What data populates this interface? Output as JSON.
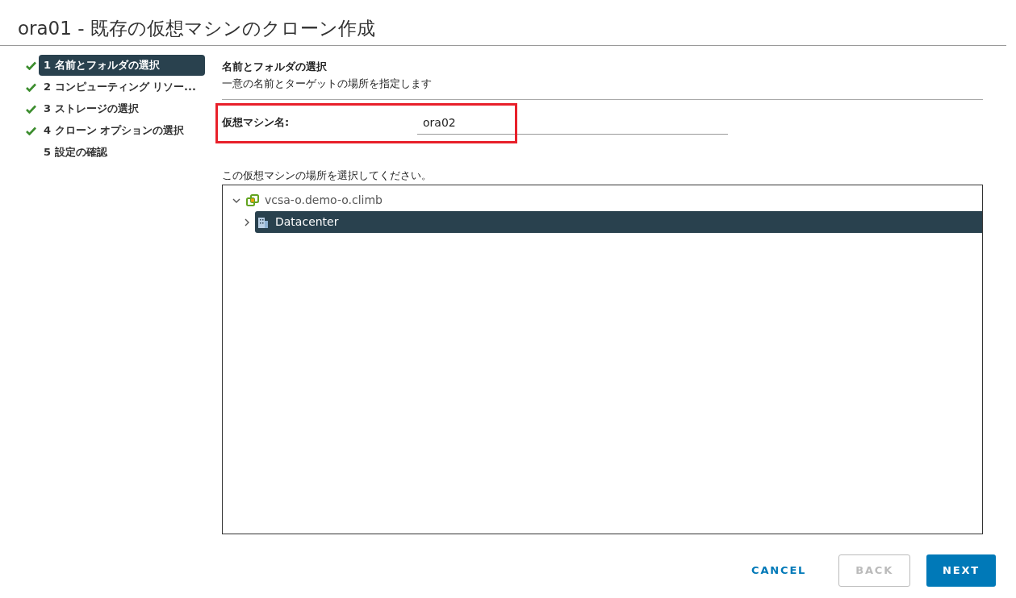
{
  "window": {
    "title": "ora01 - 既存の仮想マシンのクローン作成"
  },
  "steps": [
    {
      "label": "1 名前とフォルダの選択",
      "completed": true,
      "selected": true
    },
    {
      "label": "2 コンピューティング リソー...",
      "completed": true,
      "selected": false
    },
    {
      "label": "3 ストレージの選択",
      "completed": true,
      "selected": false
    },
    {
      "label": "4 クローン オプションの選択",
      "completed": true,
      "selected": false
    },
    {
      "label": "5 設定の確認",
      "completed": false,
      "selected": false
    }
  ],
  "section": {
    "title": "名前とフォルダの選択",
    "subtitle": "一意の名前とターゲットの場所を指定します"
  },
  "name_field": {
    "label": "仮想マシン名:",
    "value": "ora02",
    "highlighted": true
  },
  "location_prompt": "この仮想マシンの場所を選択してください。",
  "tree": [
    {
      "label": "vcsa-o.demo-o.climb",
      "kind": "vcenter",
      "expanded": true,
      "selected": false,
      "children": [
        {
          "label": "Datacenter",
          "kind": "datacenter",
          "expanded": false,
          "selected": true
        }
      ]
    }
  ],
  "buttons": [
    {
      "label": "CANCEL",
      "kind": "flat",
      "disabled": false
    },
    {
      "label": "BACK",
      "kind": "outline",
      "disabled": true
    },
    {
      "label": "NEXT",
      "kind": "primary",
      "disabled": false
    }
  ]
}
